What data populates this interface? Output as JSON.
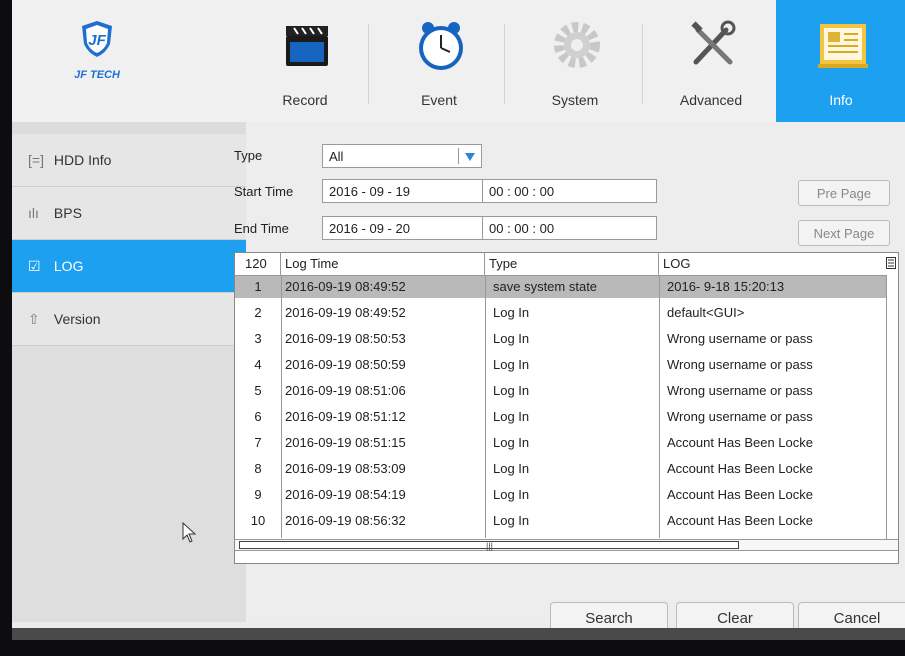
{
  "brand": {
    "name": "JF TECH"
  },
  "tabs": [
    {
      "label": "Record",
      "icon": "record-icon"
    },
    {
      "label": "Event",
      "icon": "clock-icon"
    },
    {
      "label": "System",
      "icon": "gear-icon"
    },
    {
      "label": "Advanced",
      "icon": "tools-icon"
    },
    {
      "label": "Info",
      "icon": "info-icon",
      "active": true
    }
  ],
  "sidebar": {
    "items": [
      {
        "label": "HDD Info",
        "glyph": "[=]"
      },
      {
        "label": "BPS",
        "glyph": "ılı"
      },
      {
        "label": "LOG",
        "glyph": "☑",
        "active": true
      },
      {
        "label": "Version",
        "glyph": "⇧"
      }
    ]
  },
  "filters": {
    "type_label": "Type",
    "type_value": "All",
    "start_label": "Start Time",
    "start_date": "2016   - 09  -  19",
    "start_time": "00  :  00  :  00",
    "end_label": "End Time",
    "end_date": "2016   - 09  -  20",
    "end_time": "00  :  00  :  00",
    "pre_page": "Pre Page",
    "next_page": "Next Page"
  },
  "log_table": {
    "count": "120",
    "columns": [
      "Log Time",
      "Type",
      "LOG"
    ],
    "rows": [
      {
        "n": "1",
        "time": "2016-09-19 08:49:52",
        "type": "save system state",
        "log": "2016- 9-18 15:20:13",
        "selected": true
      },
      {
        "n": "2",
        "time": "2016-09-19 08:49:52",
        "type": "Log In",
        "log": "default<GUI>"
      },
      {
        "n": "3",
        "time": "2016-09-19 08:50:53",
        "type": "Log In",
        "log": "Wrong username or pass"
      },
      {
        "n": "4",
        "time": "2016-09-19 08:50:59",
        "type": "Log In",
        "log": "Wrong username or pass"
      },
      {
        "n": "5",
        "time": "2016-09-19 08:51:06",
        "type": "Log In",
        "log": "Wrong username or pass"
      },
      {
        "n": "6",
        "time": "2016-09-19 08:51:12",
        "type": "Log In",
        "log": "Wrong username or pass"
      },
      {
        "n": "7",
        "time": "2016-09-19 08:51:15",
        "type": "Log In",
        "log": "Account Has Been Locke"
      },
      {
        "n": "8",
        "time": "2016-09-19 08:53:09",
        "type": "Log In",
        "log": "Account Has Been Locke"
      },
      {
        "n": "9",
        "time": "2016-09-19 08:54:19",
        "type": "Log In",
        "log": "Account Has Been Locke"
      },
      {
        "n": "10",
        "time": "2016-09-19 08:56:32",
        "type": "Log In",
        "log": "Account Has Been Locke"
      }
    ]
  },
  "buttons": {
    "search": "Search",
    "clear": "Clear",
    "cancel": "Cancel"
  },
  "colors": {
    "accent": "#1ea0f0",
    "selected_row": "#b9b9b9"
  }
}
